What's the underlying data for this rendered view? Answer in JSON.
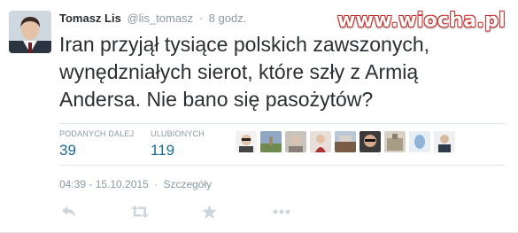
{
  "tweet": {
    "fullname": "Tomasz Lis",
    "username": "@lis_tomasz",
    "separator": "·",
    "time": "8 godz.",
    "text_lines": [
      "Iran przyjął tysiące polskich zawszonych,",
      "wynędzniałych sierot, które szły z Armią",
      "Andersa. Nie bano się pasożytów?"
    ]
  },
  "stats": {
    "retweets_label": "PODANYCH DALEJ",
    "retweets_value": "39",
    "favorites_label": "ULUBIONYCH",
    "favorites_value": "119"
  },
  "meta": {
    "timestamp": "04:39 - 15.10.2015",
    "dot": "·",
    "details_link": "Szczegóły"
  },
  "watermark": "www.wiocha.pl",
  "icons": {
    "reply": "reply-icon",
    "retweet": "retweet-icon",
    "favorite": "star-icon",
    "more": "more-dots-icon"
  },
  "colors": {
    "text": "#292f33",
    "muted": "#8899a6",
    "stat_value": "#1b6c97",
    "divider": "#e1e8ed",
    "icon": "#ccd6dd",
    "watermark_outline": "#c9302c"
  }
}
